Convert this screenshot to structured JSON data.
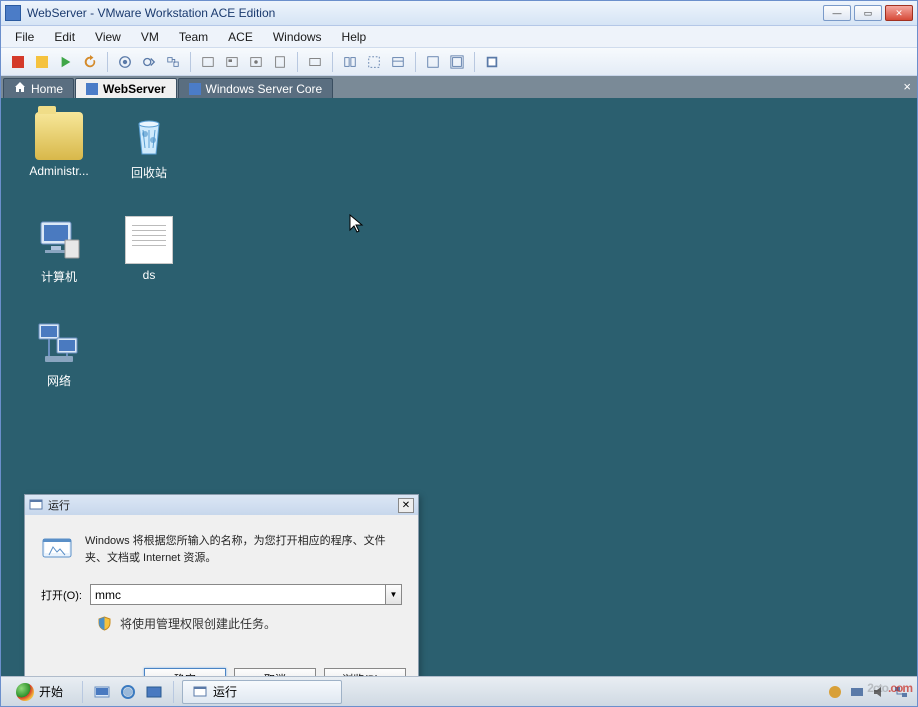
{
  "window": {
    "title": "WebServer - VMware Workstation ACE Edition"
  },
  "menu": [
    "File",
    "Edit",
    "View",
    "VM",
    "Team",
    "ACE",
    "Windows",
    "Help"
  ],
  "tabs": {
    "home": "Home",
    "webserver": "WebServer",
    "wincore": "Windows Server Core"
  },
  "desktop": {
    "admin": "Administr...",
    "recycle": "回收站",
    "computer": "计算机",
    "ds": "ds",
    "network": "网络"
  },
  "run": {
    "title": "运行",
    "desc": "Windows 将根据您所输入的名称，为您打开相应的程序、文件夹、文档或 Internet 资源。",
    "open_label": "打开(O):",
    "input_value": "mmc",
    "admin_note": "将使用管理权限创建此任务。",
    "ok": "确定",
    "cancel": "取消",
    "browse": "浏览(B)..."
  },
  "taskbar": {
    "start": "开始",
    "task_run": "运行"
  },
  "watermark": {
    "a": "2cto",
    "b": ".com"
  }
}
